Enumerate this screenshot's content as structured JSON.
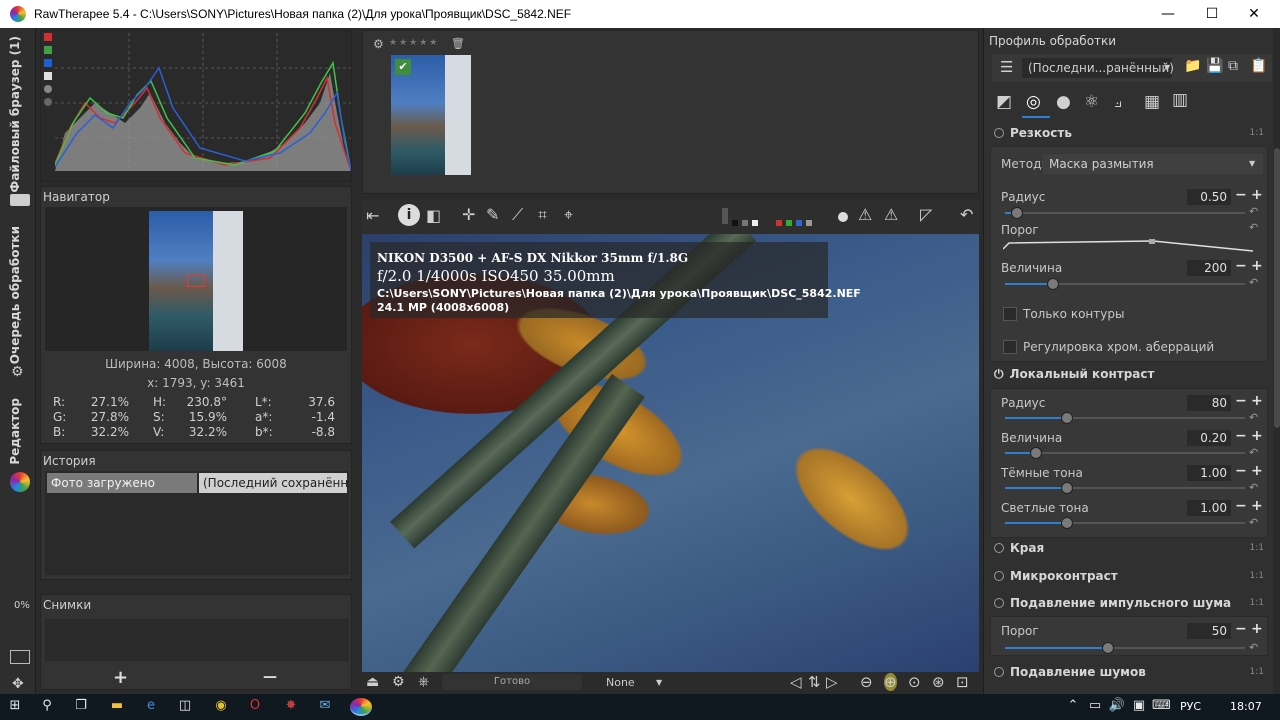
{
  "window": {
    "title": "RawTherapee 5.4 - C:\\Users\\SONY\\Pictures\\Новая папка (2)\\Для урока\\Проявщик\\DSC_5842.NEF",
    "min": "—",
    "max": "☐",
    "close": "✕"
  },
  "vtabs": {
    "file_browser": "Файловый браузер (1)",
    "queue": "Очередь обработки",
    "editor": "Редактор",
    "progress": "0%"
  },
  "navigator": {
    "title": "Навигатор",
    "size": "Ширина: 4008, Высота: 6008",
    "coords": "x: 1793, y: 3461",
    "readout": {
      "r_label": "R:",
      "r": "27.1%",
      "g_label": "G:",
      "g": "27.8%",
      "b_label": "B:",
      "b": "32.2%",
      "h_label": "H:",
      "h": "230.8°",
      "s_label": "S:",
      "s": "15.9%",
      "v_label": "V:",
      "v": "32.2%",
      "l_label": "L*:",
      "l": "37.6",
      "a_label": "a*:",
      "a": "-1.4",
      "bb_label": "b*:",
      "bb": "-8.8"
    }
  },
  "history": {
    "title": "История",
    "col1": "Фото загружено",
    "col2": "(Последний сохранённ..."
  },
  "snapshots": {
    "title": "Снимки",
    "add": "+",
    "remove": "—"
  },
  "image_info": {
    "camera": "NIKON D3500 + AF-S DX Nikkor 35mm f/1.8G",
    "exposure": "f/2.0  1/4000s  ISO450  35.00mm",
    "path": "C:\\Users\\SONY\\Pictures\\Новая папка (2)\\Для урока\\Проявщик\\DSC_5842.NEF",
    "mp": "24.1 MP (4008x6008)"
  },
  "statusbar": {
    "ready": "Готово",
    "profile_select": "None"
  },
  "right": {
    "profile_title": "Профиль обработки",
    "profile_value": "(Последни...ранённый)",
    "sharpening": {
      "title": "Резкость",
      "method_label": "Метод:",
      "method_value": "Маска размытия",
      "radius_label": "Радиус",
      "radius": "0.50",
      "radius_frac": 0.05,
      "threshold_label": "Порог",
      "amount_label": "Величина",
      "amount": "200",
      "amount_frac": 0.2,
      "edges_only": "Только контуры",
      "halo": "Регулировка хром. аберраций"
    },
    "local_contrast": {
      "title": "Локальный контраст",
      "radius_label": "Радиус",
      "radius": "80",
      "radius_frac": 0.26,
      "amount_label": "Величина",
      "amount": "0.20",
      "amount_frac": 0.13,
      "darkness_label": "Тёмные тона",
      "darkness": "1.00",
      "darkness_frac": 0.26,
      "lightness_label": "Светлые тона",
      "lightness": "1.00",
      "lightness_frac": 0.26
    },
    "edges": "Края",
    "microcontrast": "Микроконтраст",
    "impulse": {
      "title": "Подавление импульсного шума",
      "threshold_label": "Порог",
      "threshold": "50",
      "threshold_frac": 0.43
    },
    "noise": "Подавление шумов",
    "one_to_one": "1:1"
  },
  "taskbar": {
    "lang": "РУС",
    "time": "18:07"
  }
}
